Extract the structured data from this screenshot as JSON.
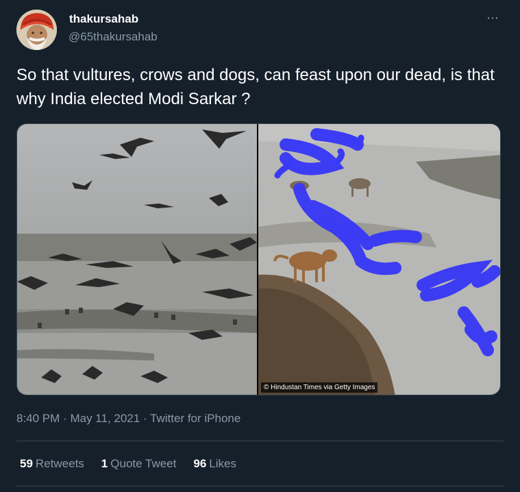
{
  "author": {
    "display_name": "thakursahab",
    "handle": "@65thakursahab"
  },
  "tweet": {
    "text": "So that vultures, crows and dogs, can feast upon our dead, is that why India elected Modi Sarkar ?",
    "more_icon": "⋯"
  },
  "media": {
    "left_photo": "birds-over-river",
    "right_photo": "dogs-at-riverbank",
    "credit": "© Hindustan Times via Getty Images"
  },
  "meta": {
    "time": "8:40 PM",
    "separator": "·",
    "date": "May 11, 2021",
    "source": "Twitter for iPhone"
  },
  "stats": {
    "retweets_count": "59",
    "retweets_label": "Retweets",
    "quotes_count": "1",
    "quotes_label": "Quote Tweet",
    "likes_count": "96",
    "likes_label": "Likes"
  },
  "colors": {
    "background": "#15202b",
    "text_primary": "#ffffff",
    "text_secondary": "#8899a6",
    "divider": "#38444d",
    "scribble": "#3a3af5"
  }
}
